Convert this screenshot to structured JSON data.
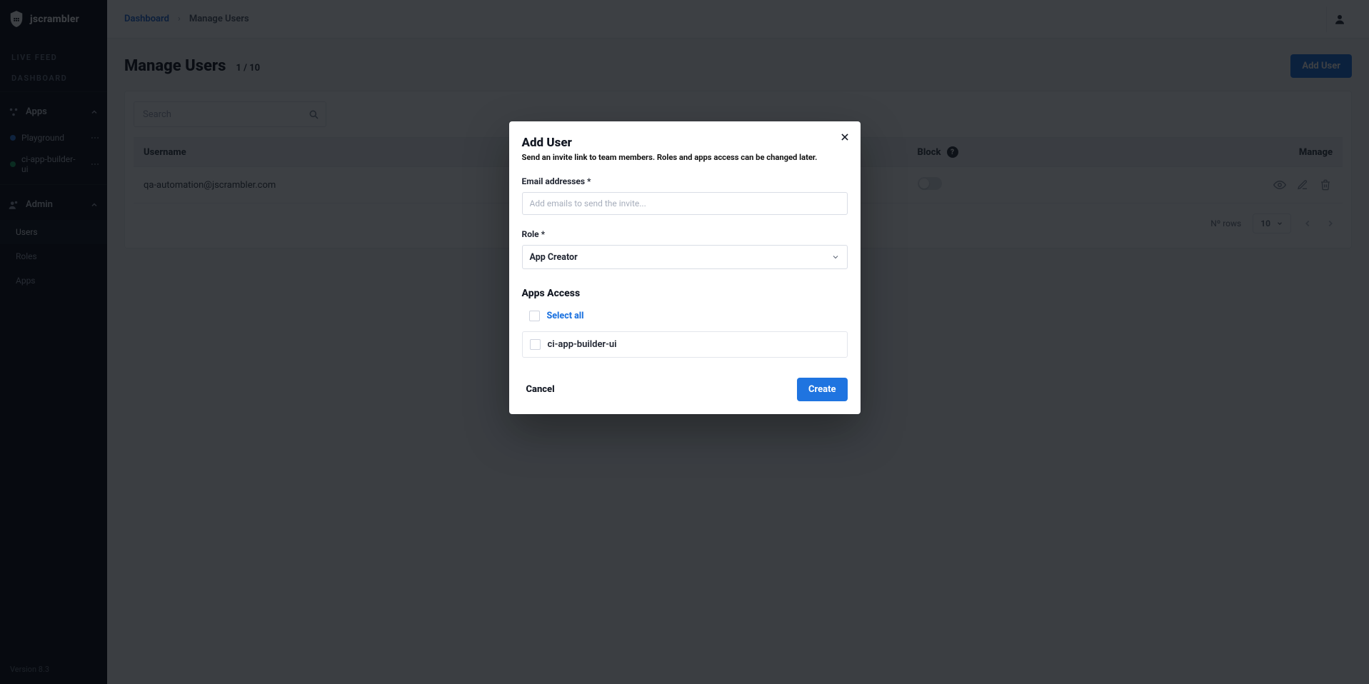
{
  "brand": {
    "name": "jscrambler"
  },
  "sidebar": {
    "primary": [
      "LIVE FEED",
      "DASHBOARD"
    ],
    "apps": {
      "label": "Apps",
      "items": [
        {
          "label": "Playground",
          "color": "#2f7de1"
        },
        {
          "label": "ci-app-builder-ui",
          "color": "#1aa260"
        }
      ]
    },
    "admin": {
      "label": "Admin",
      "items": [
        "Users",
        "Roles",
        "Apps"
      ],
      "active": "Users"
    },
    "version": "Version 8.3"
  },
  "breadcrumbs": {
    "root": "Dashboard",
    "current": "Manage Users"
  },
  "page": {
    "title": "Manage Users",
    "count": "1 / 10",
    "addButton": "Add User"
  },
  "search": {
    "placeholder": "Search"
  },
  "table": {
    "columns": {
      "username": "Username",
      "block": "Block",
      "manage": "Manage"
    },
    "rows": [
      {
        "username": "qa-automation@jscrambler.com",
        "blocked": false
      }
    ],
    "rowsLabel": "Nº rows",
    "rowsValue": "10"
  },
  "modal": {
    "title": "Add User",
    "subtitle": "Send an invite link to team members. Roles and apps access can be changed later.",
    "emailLabel": "Email addresses *",
    "emailPlaceholder": "Add emails to send the invite...",
    "roleLabel": "Role *",
    "roleValue": "App Creator",
    "appsSection": "Apps Access",
    "selectAll": "Select all",
    "apps": [
      "ci-app-builder-ui"
    ],
    "cancel": "Cancel",
    "create": "Create"
  }
}
